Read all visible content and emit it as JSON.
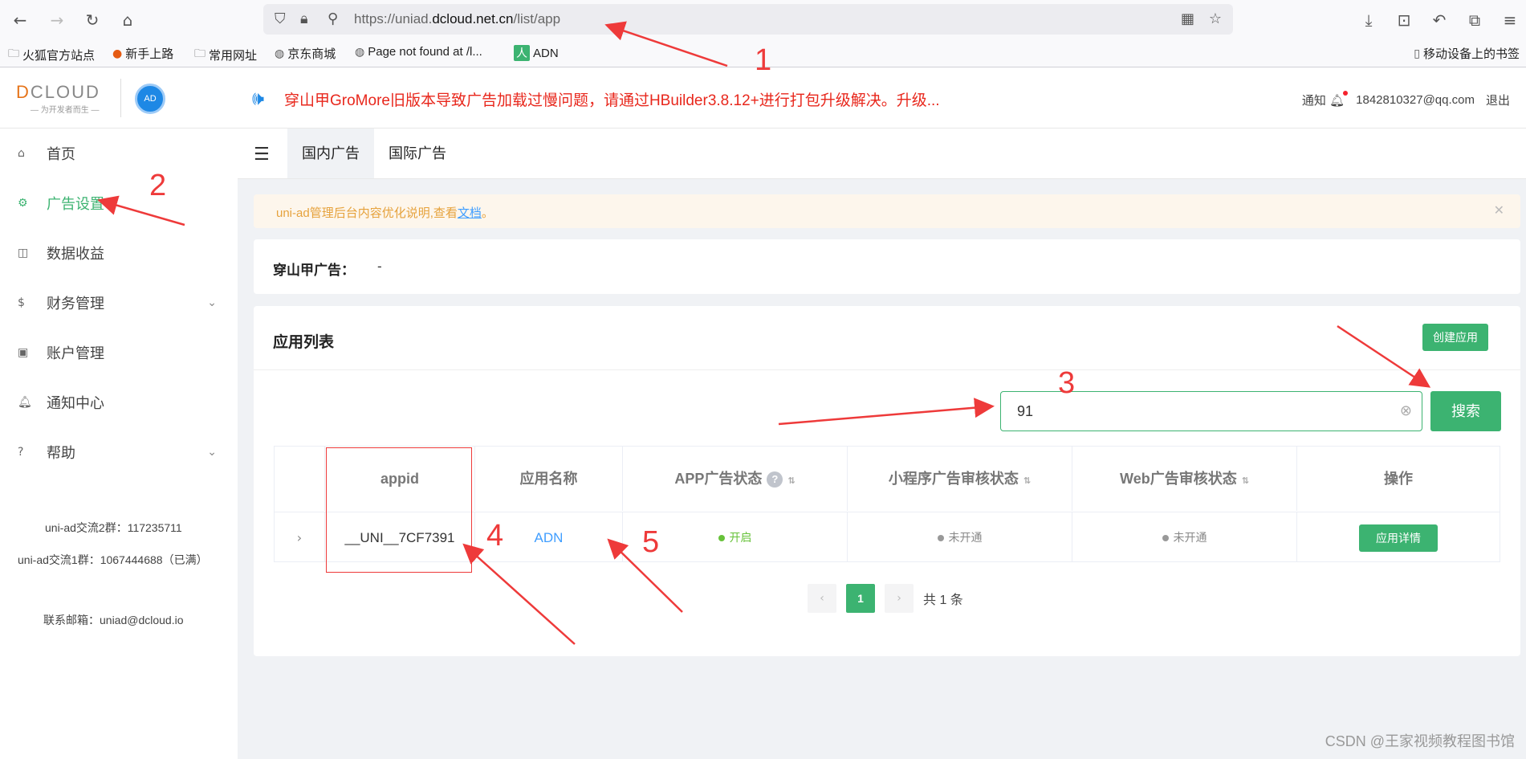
{
  "browser": {
    "url_prefix": "https://uniad.",
    "url_domain": "dcloud.net.cn",
    "url_path": "/list/app",
    "bookmarks": [
      "火狐官方站点",
      "新手上路",
      "常用网址",
      "京东商城",
      "Page not found at /l...",
      "ADN"
    ],
    "mobile_bookmarks": "移动设备上的书签"
  },
  "header": {
    "logo_text": "CLOUD",
    "logo_letter": "D",
    "logo_tagline": "— 为开发者而生 —",
    "ad_badge": "AD",
    "notice": "穿山甲GroMore旧版本导致广告加载过慢问题，请通过HBuilder3.8.12+进行打包升级解决。升级...",
    "notify_label": "通知",
    "account": "1842810327@qq.com",
    "logout": "退出"
  },
  "sidebar": {
    "items": [
      {
        "label": "首页",
        "icon": "⌂"
      },
      {
        "label": "广告设置",
        "icon": "⚙"
      },
      {
        "label": "数据收益",
        "icon": "◫"
      },
      {
        "label": "财务管理",
        "icon": "$"
      },
      {
        "label": "账户管理",
        "icon": "▣"
      },
      {
        "label": "通知中心",
        "icon": "♪"
      },
      {
        "label": "帮助",
        "icon": "?"
      }
    ],
    "group2": "uni-ad交流2群：117235711",
    "group1": "uni-ad交流1群：1067444688（已满）",
    "email": "联系邮箱：uniad@dcloud.io"
  },
  "tabs": [
    "国内广告",
    "国际广告"
  ],
  "alert": {
    "text": "uni-ad管理后台内容优化说明,查看",
    "link": "文档",
    "end": "。"
  },
  "pangle": {
    "label": "穿山甲广告：",
    "value": "-"
  },
  "applist": {
    "title": "应用列表",
    "create_button": "创建应用",
    "search_value": "91",
    "search_button": "搜索",
    "columns": [
      "appid",
      "应用名称",
      "APP广告状态",
      "小程序广告审核状态",
      "Web广告审核状态",
      "操作"
    ],
    "rows": [
      {
        "appid": "__UNI__7CF7391",
        "name": "ADN",
        "app_status": "开启",
        "mini_status": "未开通",
        "web_status": "未开通",
        "action": "应用详情"
      }
    ],
    "pager": {
      "current": "1",
      "total": "共 1 条"
    }
  },
  "annotations": [
    "1",
    "2",
    "3",
    "4",
    "5"
  ],
  "watermark": "CSDN @王家视频教程图书馆",
  "colors": {
    "accent": "#3cb371",
    "alert": "#e6a23c",
    "annotation": "#ee3a3a",
    "notice": "#e8271c"
  }
}
